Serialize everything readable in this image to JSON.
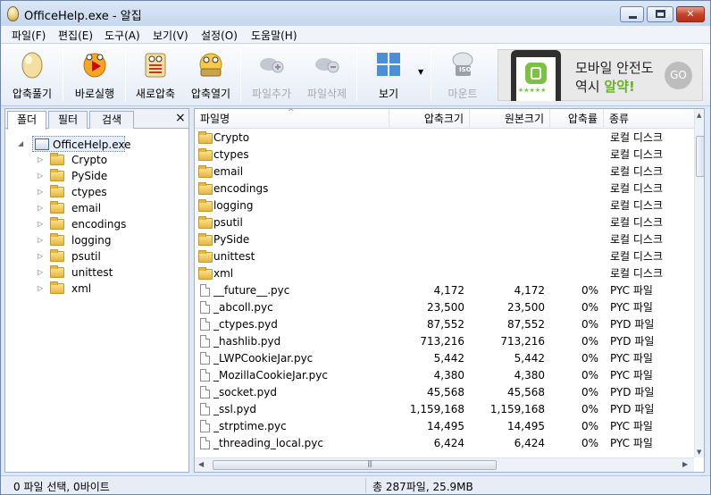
{
  "window": {
    "title": "OfficeHelp.exe - 알집"
  },
  "menu": [
    "파일(F)",
    "편집(E)",
    "도구(A)",
    "보기(V)",
    "설정(O)",
    "도움말(H)"
  ],
  "toolbar": {
    "extract": "압축풀기",
    "run": "바로실행",
    "new_archive": "새로압축",
    "open_archive": "압축열기",
    "add_file": "파일추가",
    "delete_file": "파일삭제",
    "view": "보기",
    "mount": "마운트"
  },
  "ad": {
    "line1": "모바일 안전도",
    "line2_prefix": "역시 ",
    "line2_highlight": "알약!",
    "go": "GO",
    "stars": "★★★★★",
    "iso": "ISO"
  },
  "left_pane": {
    "tabs": [
      "폴더",
      "필터",
      "검색"
    ],
    "close": "×",
    "root": "OfficeHelp.exe",
    "folders": [
      "Crypto",
      "PySide",
      "ctypes",
      "email",
      "encodings",
      "logging",
      "psutil",
      "unittest",
      "xml"
    ]
  },
  "columns": {
    "name": "파일명",
    "compressed": "압축크기",
    "original": "원본크기",
    "ratio": "압축률",
    "type": "종류"
  },
  "rows": [
    {
      "name": "Crypto",
      "comp": "",
      "orig": "",
      "ratio": "",
      "type": "로컬 디스크",
      "folder": true
    },
    {
      "name": "ctypes",
      "comp": "",
      "orig": "",
      "ratio": "",
      "type": "로컬 디스크",
      "folder": true
    },
    {
      "name": "email",
      "comp": "",
      "orig": "",
      "ratio": "",
      "type": "로컬 디스크",
      "folder": true
    },
    {
      "name": "encodings",
      "comp": "",
      "orig": "",
      "ratio": "",
      "type": "로컬 디스크",
      "folder": true
    },
    {
      "name": "logging",
      "comp": "",
      "orig": "",
      "ratio": "",
      "type": "로컬 디스크",
      "folder": true
    },
    {
      "name": "psutil",
      "comp": "",
      "orig": "",
      "ratio": "",
      "type": "로컬 디스크",
      "folder": true
    },
    {
      "name": "PySide",
      "comp": "",
      "orig": "",
      "ratio": "",
      "type": "로컬 디스크",
      "folder": true
    },
    {
      "name": "unittest",
      "comp": "",
      "orig": "",
      "ratio": "",
      "type": "로컬 디스크",
      "folder": true
    },
    {
      "name": "xml",
      "comp": "",
      "orig": "",
      "ratio": "",
      "type": "로컬 디스크",
      "folder": true
    },
    {
      "name": "__future__.pyc",
      "comp": "4,172",
      "orig": "4,172",
      "ratio": "0%",
      "type": "PYC 파일",
      "folder": false
    },
    {
      "name": "_abcoll.pyc",
      "comp": "23,500",
      "orig": "23,500",
      "ratio": "0%",
      "type": "PYC 파일",
      "folder": false
    },
    {
      "name": "_ctypes.pyd",
      "comp": "87,552",
      "orig": "87,552",
      "ratio": "0%",
      "type": "PYD 파일",
      "folder": false
    },
    {
      "name": "_hashlib.pyd",
      "comp": "713,216",
      "orig": "713,216",
      "ratio": "0%",
      "type": "PYD 파일",
      "folder": false
    },
    {
      "name": "_LWPCookieJar.pyc",
      "comp": "5,442",
      "orig": "5,442",
      "ratio": "0%",
      "type": "PYC 파일",
      "folder": false
    },
    {
      "name": "_MozillaCookieJar.pyc",
      "comp": "4,380",
      "orig": "4,380",
      "ratio": "0%",
      "type": "PYC 파일",
      "folder": false
    },
    {
      "name": "_socket.pyd",
      "comp": "45,568",
      "orig": "45,568",
      "ratio": "0%",
      "type": "PYD 파일",
      "folder": false
    },
    {
      "name": "_ssl.pyd",
      "comp": "1,159,168",
      "orig": "1,159,168",
      "ratio": "0%",
      "type": "PYD 파일",
      "folder": false
    },
    {
      "name": "_strptime.pyc",
      "comp": "14,495",
      "orig": "14,495",
      "ratio": "0%",
      "type": "PYC 파일",
      "folder": false
    },
    {
      "name": "_threading_local.pyc",
      "comp": "6,424",
      "orig": "6,424",
      "ratio": "0%",
      "type": "PYC 파일",
      "folder": false
    }
  ],
  "status": {
    "selection": "0 파일 선택,  0바이트",
    "total": "총 287파일,  25.9MB"
  }
}
